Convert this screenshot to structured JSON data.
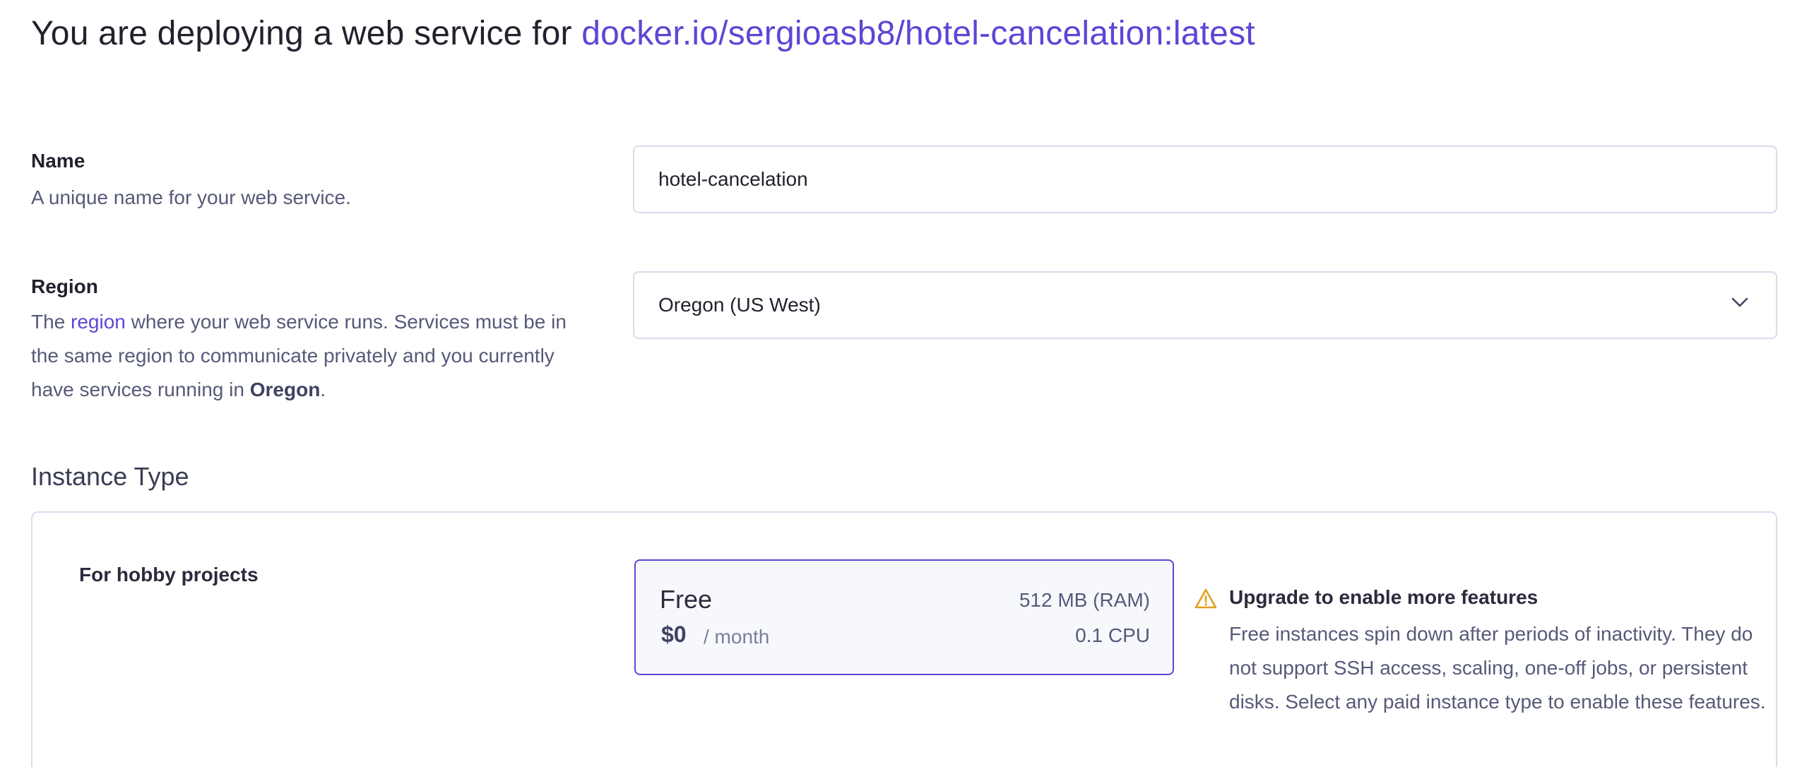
{
  "header": {
    "prefix": "You are deploying a web service for ",
    "image": "docker.io/sergioasb8/hotel-cancelation:latest"
  },
  "name_field": {
    "label": "Name",
    "description": "A unique name for your web service.",
    "value": "hotel-cancelation"
  },
  "region_field": {
    "label": "Region",
    "desc_before": "The ",
    "desc_link": "region",
    "desc_middle": " where your web service runs. Services must be in the same region to communicate privately and you currently have services running in ",
    "desc_bold": "Oregon",
    "desc_after": ".",
    "selected": "Oregon (US West)"
  },
  "instance": {
    "title": "Instance Type",
    "group_label": "For hobby projects",
    "plan": {
      "name": "Free",
      "price": "$0",
      "period": "/ month",
      "ram": "512 MB (RAM)",
      "cpu": "0.1 CPU"
    },
    "notice": {
      "icon": "warning-icon",
      "title": "Upgrade to enable more features",
      "body": "Free instances spin down after periods of inactivity. They do not support SSH access, scaling, one-off jobs, or persistent disks. Select any paid instance type to enable these features."
    }
  },
  "colors": {
    "accent": "#5a47d6",
    "warning": "#e0a020",
    "border": "#d9dcec"
  }
}
